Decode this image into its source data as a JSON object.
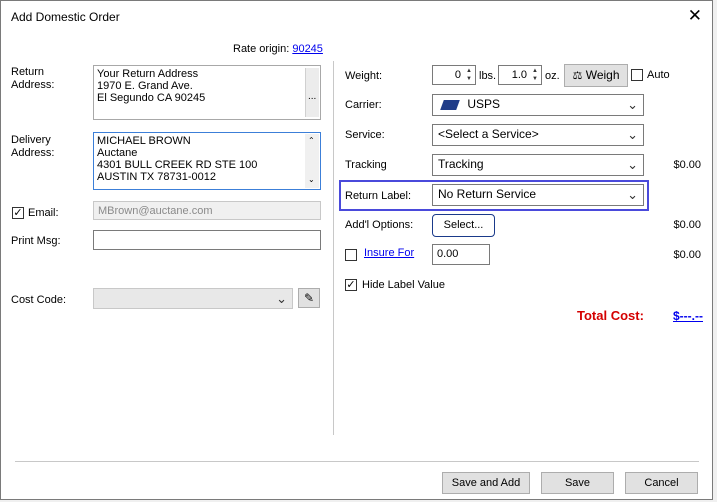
{
  "window": {
    "title": "Add Domestic Order"
  },
  "rate_origin": {
    "label": "Rate origin:",
    "zip": "90245"
  },
  "return_address": {
    "label_line1": "Return",
    "label_line2": "Address:",
    "lines": [
      "Your Return Address",
      "1970 E. Grand Ave.",
      "El Segundo CA 90245"
    ],
    "more_button": "..."
  },
  "delivery_address": {
    "label_line1": "Delivery",
    "label_line2": "Address:",
    "lines": [
      "MICHAEL BROWN",
      "Auctane",
      "4301 BULL CREEK RD STE 100",
      "AUSTIN TX 78731-0012"
    ]
  },
  "email": {
    "label": "Email:",
    "value": "MBrown@auctane.com",
    "checked": true
  },
  "print_msg": {
    "label": "Print Msg:",
    "value": ""
  },
  "cost_code": {
    "label": "Cost Code:",
    "value": ""
  },
  "weight": {
    "label": "Weight:",
    "lbs_value": "0",
    "lbs_unit": "lbs.",
    "oz_value": "1.0",
    "oz_unit": "oz.",
    "weigh_button": "Weigh",
    "auto_label": "Auto"
  },
  "carrier": {
    "label": "Carrier:",
    "value": "USPS"
  },
  "service": {
    "label": "Service:",
    "value": "<Select a Service>"
  },
  "tracking": {
    "label": "Tracking",
    "value": "Tracking",
    "cost": "$0.00"
  },
  "return_label": {
    "label": "Return Label:",
    "value": "No Return Service"
  },
  "addl_options": {
    "label": "Add'l Options:",
    "button": "Select...",
    "cost": "$0.00"
  },
  "insure": {
    "label": "Insure For",
    "value": "0.00",
    "cost": "$0.00"
  },
  "hide_label": {
    "label": "Hide Label Value",
    "checked": true
  },
  "total": {
    "label": "Total Cost:",
    "value": "$---.--"
  },
  "footer": {
    "save_and_add": "Save and Add",
    "save": "Save",
    "cancel": "Cancel"
  },
  "colors": {
    "total_label": "#d40000",
    "highlight_border": "#4a4adb",
    "link": "#0000ee"
  }
}
